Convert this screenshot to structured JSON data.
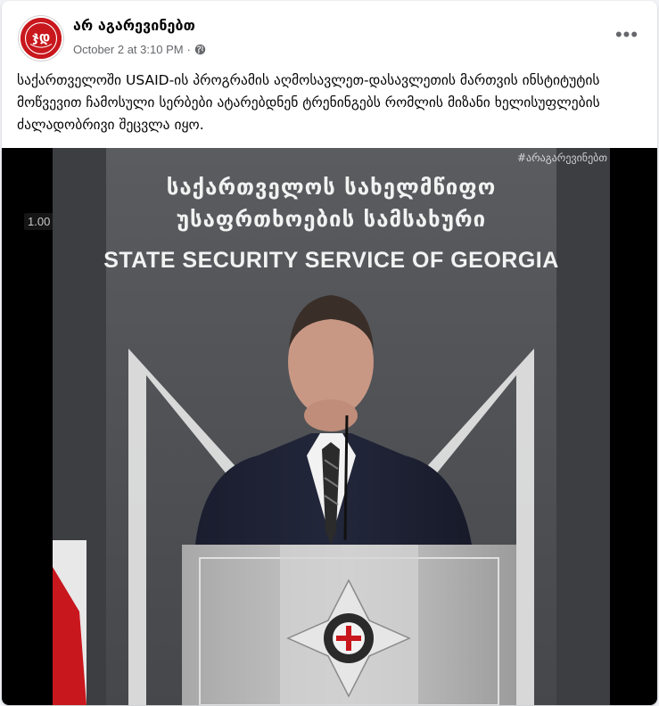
{
  "post": {
    "author": "არ აგარევინებთ",
    "timestamp": "October 2 at 3:10 PM",
    "separator": "·",
    "privacy_icon": "globe-icon",
    "more_icon": "more-options-icon",
    "more_label": "•••",
    "text": "საქართველოში USAID-ის პროგრამის აღმოსავლეთ-დასავლეთის მართვის ინსტიტუტის მოწვევით ჩამოსული სერბები ატარებდნენ ტრენინგებს რომლის მიზანი ხელისუფლების ძალადობრივი შეცვლა იყო."
  },
  "avatar": {
    "brand_color": "#c8171d",
    "icon": "page-logo"
  },
  "video": {
    "watermark": "#არაგარევინებთ",
    "playback_speed": "1.00",
    "sign": {
      "line1": "საქართველოს სახელმწიფო",
      "line2": "უსაფრთხოების სამსახური",
      "line3": "STATE SECURITY SERVICE OF GEORGIA"
    }
  },
  "colors": {
    "text_primary": "#050505",
    "text_secondary": "#65676b",
    "card_bg": "#ffffff",
    "page_bg": "#f0f2f5"
  }
}
